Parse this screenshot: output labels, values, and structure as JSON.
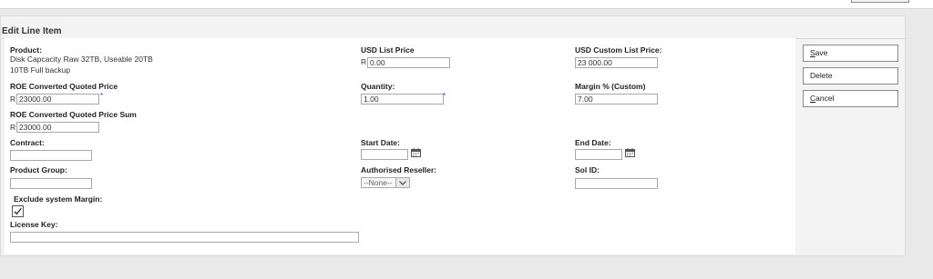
{
  "panel": {
    "title": "Edit Line Item"
  },
  "product": {
    "label": "Product:",
    "line1": "Disk Capcacity Raw 32TB, Useable 20TB",
    "line2": "10TB Full backup"
  },
  "usd_list_price": {
    "label": "USD List Price",
    "currency": "R",
    "value": "0.00"
  },
  "usd_custom_list_price": {
    "label": "USD Custom List Price:",
    "value": "23 000.00"
  },
  "roe_quoted_price": {
    "label": "ROE Converted Quoted Price",
    "currency": "R",
    "value": "23000.00",
    "required_mark": "*"
  },
  "quantity": {
    "label": "Quantity:",
    "value": "1.00",
    "required_mark": "*"
  },
  "margin": {
    "label": "Margin % (Custom)",
    "value": "7.00"
  },
  "roe_quoted_price_sum": {
    "label": "ROE Converted Quoted Price Sum",
    "currency": "R",
    "value": "23000.00"
  },
  "contract": {
    "label": "Contract:",
    "value": ""
  },
  "start_date": {
    "label": "Start Date:",
    "value": ""
  },
  "end_date": {
    "label": "End Date:",
    "value": ""
  },
  "product_group": {
    "label": "Product Group:",
    "value": ""
  },
  "authorised_reseller": {
    "label": "Authorised Reseller:",
    "selected": "--None--"
  },
  "sol_id": {
    "label": "Sol ID:",
    "value": ""
  },
  "exclude_margin": {
    "label": "Exclude system Margin:",
    "checked": true
  },
  "license_key": {
    "label": "License Key:",
    "value": ""
  },
  "buttons": {
    "save": {
      "accel": "S",
      "rest": "ave"
    },
    "delete": {
      "label": "Delete"
    },
    "cancel": {
      "accel": "C",
      "rest": "ancel"
    }
  },
  "icons": {
    "calendar": "calendar-icon",
    "checkmark": "checkmark-icon",
    "dropdown": "chevron-down-icon"
  },
  "colors": {
    "required": "#2a4cd6",
    "panel_bg": "#f3f3f3",
    "page_bg": "#e9e9e9"
  }
}
